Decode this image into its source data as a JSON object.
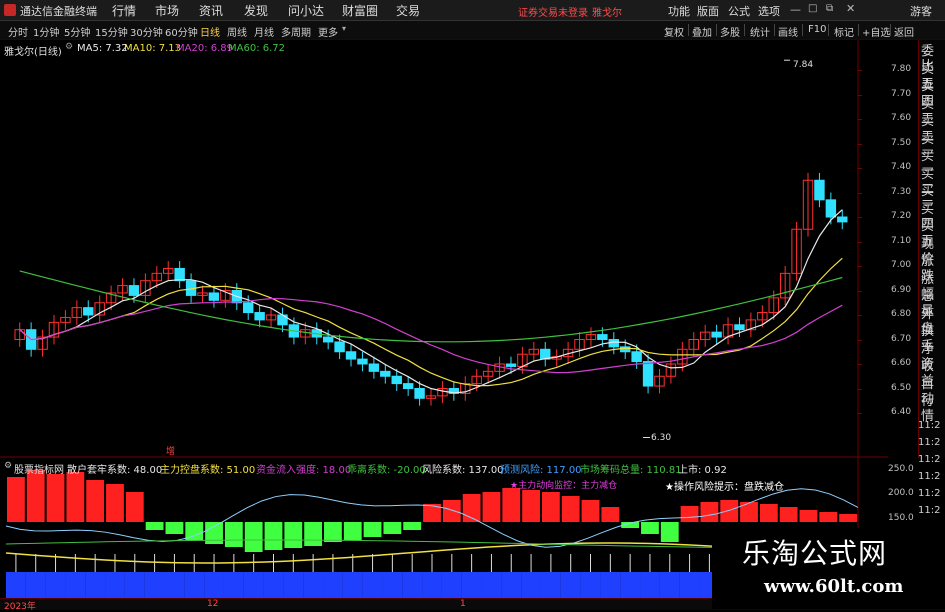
{
  "window": {
    "app_title": "通达信金融终端",
    "menus": [
      "行情",
      "市场",
      "资讯",
      "发现",
      "问小达",
      "财富圈",
      "交易"
    ],
    "login_status": "证券交易未登录",
    "stock_name": "雅戈尔",
    "right_menus": [
      "功能",
      "版面",
      "公式",
      "选项"
    ],
    "user": "游客"
  },
  "toolbar": {
    "timeframes": [
      "分时",
      "1分钟",
      "5分钟",
      "15分钟",
      "30分钟",
      "60分钟",
      "日线",
      "周线",
      "月线",
      "多周期",
      "更多"
    ],
    "active_timeframe": "日线",
    "right_buttons": [
      "复权",
      "叠加",
      "多股",
      "统计",
      "画线",
      "F10",
      "标记",
      "+自选",
      "返回"
    ]
  },
  "main_chart": {
    "title": "雅戈尔(日线)",
    "ma_labels": [
      {
        "label": "MA5: 7.32",
        "color": "#e8e8e8"
      },
      {
        "label": "MA10: 7.13",
        "color": "#f0e040"
      },
      {
        "label": "MA20: 6.89",
        "color": "#d040d0"
      },
      {
        "label": "MA60: 6.72",
        "color": "#40c040"
      }
    ],
    "high_label": "7.84",
    "low_label": "6.30",
    "signal_label": "增"
  },
  "price_axis": [
    "7.80",
    "7.70",
    "7.60",
    "7.50",
    "7.40",
    "7.30",
    "7.20",
    "7.10",
    "7.00",
    "6.90",
    "6.80",
    "6.70",
    "6.60",
    "6.50",
    "6.40"
  ],
  "sub_chart": {
    "indicator_name": "股票指标网",
    "values": [
      {
        "label": "散户套牢系数: 48.00",
        "color": "#e8e8e8"
      },
      {
        "label": "主力控盘系数: 51.00",
        "color": "#f0e040"
      },
      {
        "label": "资金流入强度: 18.00",
        "color": "#d040d0"
      },
      {
        "label": "乖离系数: -20.00",
        "color": "#40c040"
      },
      {
        "label": "风险系数: 137.00",
        "color": "#e8e8e8"
      },
      {
        "label": "预测风险: 117.00",
        "color": "#40a0ff"
      },
      {
        "label": "市场筹码总量: 110.81",
        "color": "#40c040"
      },
      {
        "label": "上市: 0.92",
        "color": "#e8e8e8"
      }
    ],
    "annotation_left": "★主力动向监控：主力减仓",
    "annotation_right": "★操作风险提示：盘跌减仓",
    "axis": [
      "250.0",
      "200.0",
      "150.0"
    ]
  },
  "right_panel": [
    "委比",
    "卖五",
    "卖四",
    "卖三",
    "卖二",
    "卖一",
    "买一",
    "买二",
    "买三",
    "买四",
    "买五",
    "现价",
    "涨跌",
    "涨幅",
    "总量",
    "外盘",
    "换手",
    "净资",
    "收益",
    "自动",
    "行情"
  ],
  "time_column": [
    "11:2",
    "11:2",
    "11:2",
    "11:2",
    "11:2",
    "11:2"
  ],
  "bottom_axis": [
    "2023年",
    "12",
    "1"
  ],
  "watermark": {
    "line1": "乐淘公式网",
    "line2": "www.60lt.com"
  },
  "colors": {
    "up": "#ff3030",
    "down": "#30e0ff",
    "green_bar": "#40ff40",
    "blue_bar": "#2040ff",
    "red_bar": "#ff2020"
  }
}
